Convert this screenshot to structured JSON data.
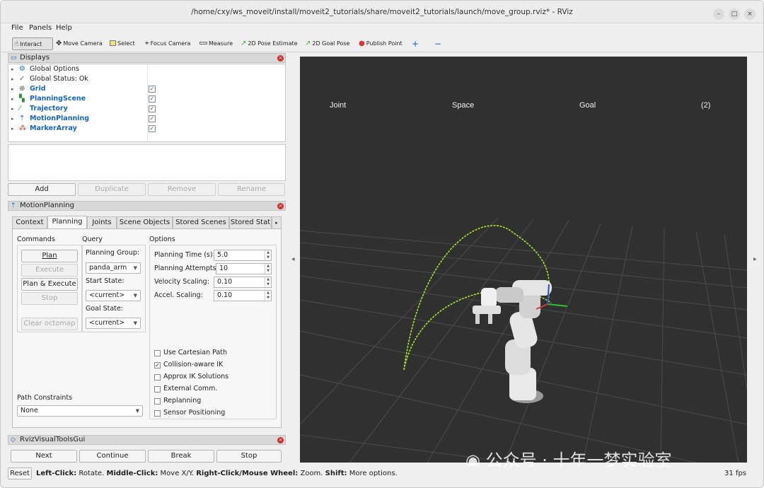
{
  "window": {
    "title": "/home/cxy/ws_moveit/install/moveit2_tutorials/share/moveit2_tutorials/launch/move_group.rviz* - RViz"
  },
  "menu": [
    "File",
    "Panels",
    "Help"
  ],
  "toolbar": {
    "interact": "Interact",
    "move_camera": "Move Camera",
    "select": "Select",
    "focus_camera": "Focus Camera",
    "measure": "Measure",
    "pose_estimate": "2D Pose Estimate",
    "goal_pose": "2D Goal Pose",
    "publish_point": "Publish Point",
    "plus": "+",
    "minus": "−"
  },
  "displays": {
    "title": "Displays",
    "items": [
      {
        "label": "Global Options",
        "icon": "gear-icon",
        "checked": null
      },
      {
        "label": "Global Status: Ok",
        "icon": "check-icon",
        "checked": null
      },
      {
        "label": "Grid",
        "icon": "grid-icon",
        "checked": true
      },
      {
        "label": "PlanningScene",
        "icon": "planning-scene-icon",
        "checked": true
      },
      {
        "label": "Trajectory",
        "icon": "trajectory-icon",
        "checked": true
      },
      {
        "label": "MotionPlanning",
        "icon": "motion-planning-icon",
        "checked": true
      },
      {
        "label": "MarkerArray",
        "icon": "marker-array-icon",
        "checked": true
      }
    ],
    "buttons": {
      "add": "Add",
      "duplicate": "Duplicate",
      "remove": "Remove",
      "rename": "Rename"
    }
  },
  "motion_planning": {
    "title": "MotionPlanning",
    "tabs": [
      "Context",
      "Planning",
      "Joints",
      "Scene Objects",
      "Stored Scenes",
      "Stored Stat"
    ],
    "selected_tab": "Planning",
    "commands": {
      "header": "Commands",
      "plan": "Plan",
      "execute": "Execute",
      "plan_execute": "Plan & Execute",
      "stop": "Stop",
      "clear_octomap": "Clear octomap"
    },
    "query": {
      "header": "Query",
      "planning_group_label": "Planning Group:",
      "planning_group": "panda_arm",
      "start_state_label": "Start State:",
      "start_state": "<current>",
      "goal_state_label": "Goal State:",
      "goal_state": "<current>"
    },
    "options": {
      "header": "Options",
      "planning_time_label": "Planning Time (s):",
      "planning_time": "5.0",
      "planning_attempts_label": "Planning Attempts:",
      "planning_attempts": "10",
      "velocity_scaling_label": "Velocity Scaling:",
      "velocity_scaling": "0.10",
      "accel_scaling_label": "Accel. Scaling:",
      "accel_scaling": "0.10",
      "checkboxes": [
        {
          "label": "Use Cartesian Path",
          "checked": false
        },
        {
          "label": "Collision-aware IK",
          "checked": true
        },
        {
          "label": "Approx IK Solutions",
          "checked": false
        },
        {
          "label": "External Comm.",
          "checked": false
        },
        {
          "label": "Replanning",
          "checked": false
        },
        {
          "label": "Sensor Positioning",
          "checked": false
        }
      ]
    },
    "path_constraints": {
      "label": "Path Constraints",
      "value": "None"
    }
  },
  "visual_tools": {
    "title": "RvizVisualToolsGui",
    "next": "Next",
    "continue": "Continue",
    "break": "Break",
    "stop": "Stop"
  },
  "viewport": {
    "labels": [
      "Joint",
      "Space",
      "Goal",
      "(2)"
    ],
    "background": "#303030",
    "trajectory_color": "#a6e22e",
    "watermark": "公众号 · 十年一梦实验室"
  },
  "status": {
    "reset": "Reset",
    "left_click_key": "Left-Click:",
    "left_click_val": "Rotate.",
    "middle_click_key": "Middle-Click:",
    "middle_click_val": "Move X/Y.",
    "right_click_key": "Right-Click/Mouse Wheel:",
    "right_click_val": "Zoom.",
    "shift_key": "Shift:",
    "shift_val": "More options.",
    "fps": "31 fps"
  }
}
